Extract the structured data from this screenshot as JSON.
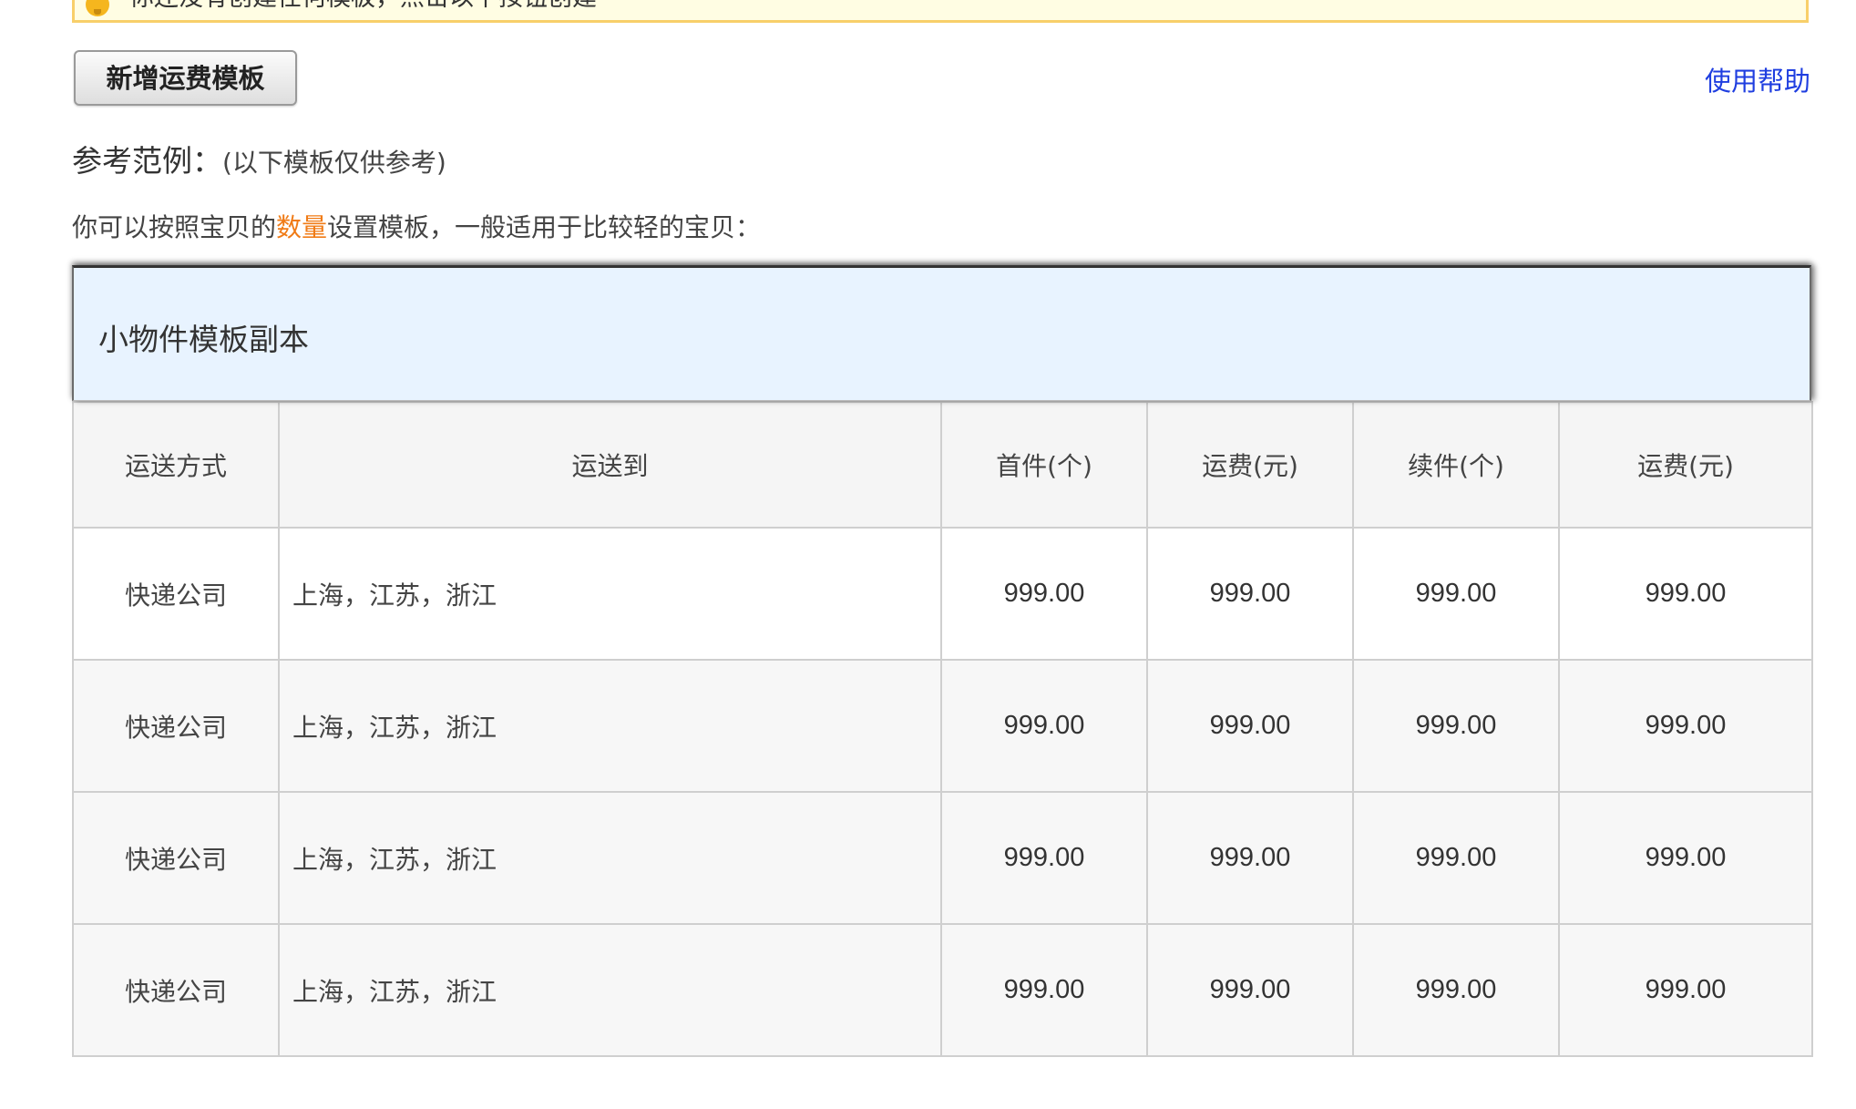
{
  "notice": {
    "icon": "lightbulb-icon",
    "text": "你还没有创建任何模板，点击以下按钮创建"
  },
  "toolbar": {
    "add_template_label": "新增运费模板",
    "help_label": "使用帮助"
  },
  "reference": {
    "title": "参考范例：",
    "note": "(以下模板仅供参考)",
    "desc_before": "你可以按照宝贝的",
    "desc_highlight": "数量",
    "desc_after": "设置模板，一般适用于比较轻的宝贝："
  },
  "template": {
    "name": "小物件模板副本",
    "columns": [
      "运送方式",
      "运送到",
      "首件(个)",
      "运费(元)",
      "续件(个)",
      "运费(元)"
    ],
    "rows": [
      {
        "method": "快递公司",
        "dest": "上海，江苏，浙江",
        "first": "999.00",
        "first_fee": "999.00",
        "extra": "999.00",
        "extra_fee": "999.00"
      },
      {
        "method": "快递公司",
        "dest": "上海，江苏，浙江",
        "first": "999.00",
        "first_fee": "999.00",
        "extra": "999.00",
        "extra_fee": "999.00"
      },
      {
        "method": "快递公司",
        "dest": "上海，江苏，浙江",
        "first": "999.00",
        "first_fee": "999.00",
        "extra": "999.00",
        "extra_fee": "999.00"
      },
      {
        "method": "快递公司",
        "dest": "上海，江苏，浙江",
        "first": "999.00",
        "first_fee": "999.00",
        "extra": "999.00",
        "extra_fee": "999.00"
      }
    ]
  },
  "colors": {
    "link": "#1f3ee0",
    "highlight": "#f07b16",
    "notice_border": "#f8cf6a",
    "notice_bg": "#fffde3",
    "template_header_bg": "#e8f3ff"
  }
}
